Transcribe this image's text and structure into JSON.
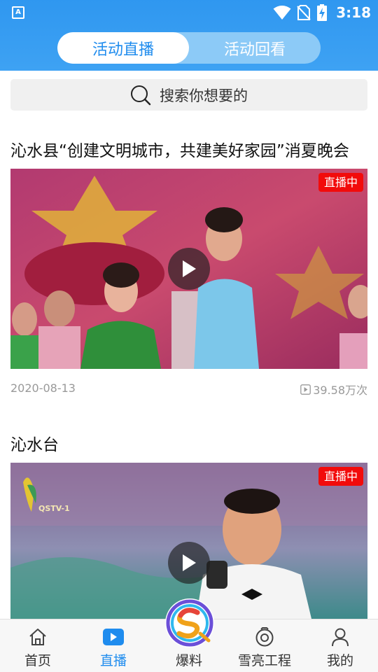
{
  "status_bar": {
    "app_badge": "A",
    "time": "3:18"
  },
  "tabs": [
    {
      "label": "活动直播",
      "active": true
    },
    {
      "label": "活动回看",
      "active": false
    }
  ],
  "search": {
    "placeholder": "搜索你想要的"
  },
  "feed": [
    {
      "title": "沁水县“创建文明城市，共建美好家园”消夏晚会",
      "badge": "直播中",
      "date": "2020-08-13",
      "views": "39.58万次"
    },
    {
      "title": "沁水台",
      "badge": "直播中",
      "channel_logo_text": "QSTV-1"
    }
  ],
  "bottom_nav": [
    {
      "label": "首页",
      "icon": "home-icon",
      "active": false
    },
    {
      "label": "直播",
      "icon": "live-play-icon",
      "active": true
    },
    {
      "label": "爆料",
      "icon": "baoliao-logo-icon",
      "active": false
    },
    {
      "label": "雪亮工程",
      "icon": "camera-icon",
      "active": false
    },
    {
      "label": "我的",
      "icon": "person-icon",
      "active": false
    }
  ],
  "colors": {
    "header_blue": "#2f97f0",
    "accent_blue": "#1f8cee",
    "live_red": "#f20b0b"
  }
}
